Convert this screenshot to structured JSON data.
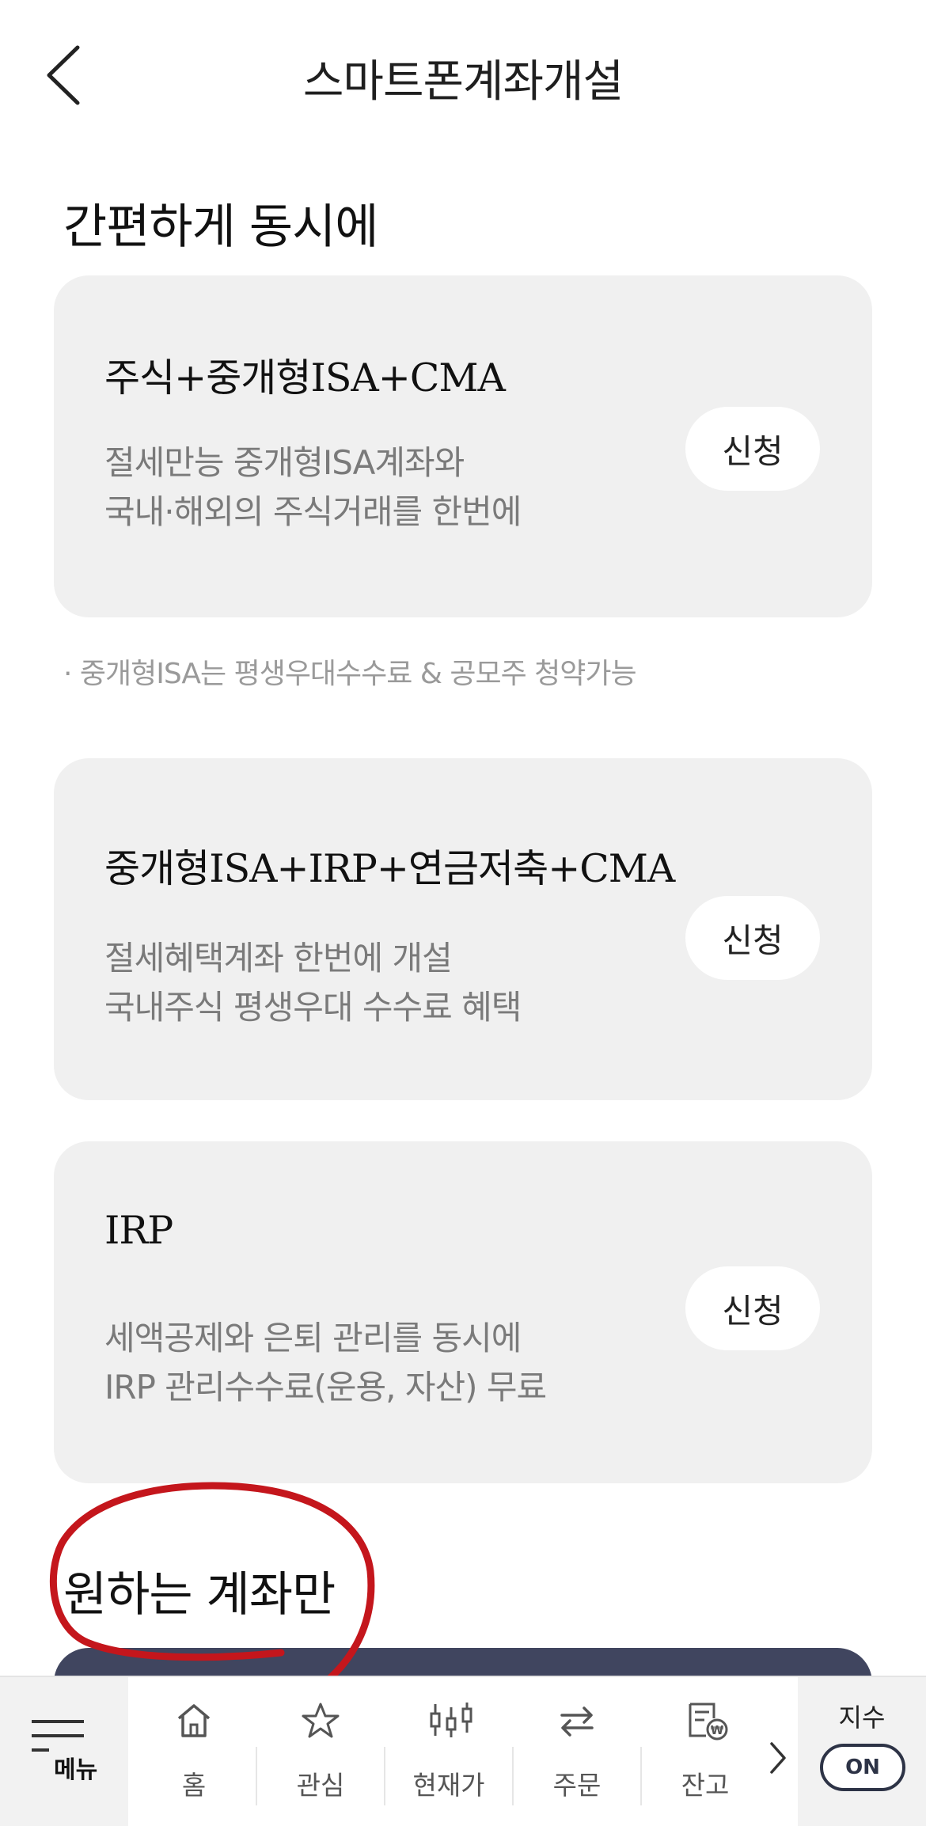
{
  "header": {
    "title": "스마트폰계좌개설"
  },
  "sections": {
    "simple": {
      "title": "간편하게 동시에"
    },
    "wanted": {
      "title": "원하는 계좌만"
    }
  },
  "cards": [
    {
      "title": "주식+중개형ISA+CMA",
      "desc": [
        "절세만능 중개형ISA계좌와",
        "국내·해외의 주식거래를 한번에"
      ],
      "button": "신청"
    },
    {
      "title": "중개형ISA+IRP+연금저축+CMA",
      "desc": [
        "절세혜택계좌 한번에 개설",
        "국내주식 평생우대 수수료 혜택"
      ],
      "button": "신청"
    },
    {
      "title": "IRP",
      "desc": [
        "세액공제와 은퇴 관리를 동시에",
        "IRP 관리수수료(운용, 자산) 무료"
      ],
      "button": "신청"
    }
  ],
  "note": "· 중개형ISA는 평생우대수수료 & 공모주 청약가능",
  "bottom_nav": {
    "menu_label": "메뉴",
    "items": [
      {
        "label": "홈",
        "icon": "home-icon"
      },
      {
        "label": "관심",
        "icon": "star-icon"
      },
      {
        "label": "현재가",
        "icon": "candlestick-icon"
      },
      {
        "label": "주문",
        "icon": "swap-icon"
      },
      {
        "label": "잔고",
        "icon": "balance-icon"
      }
    ],
    "index_label": "지수",
    "index_toggle": "ON"
  },
  "colors": {
    "card_bg": "#f0f0f0",
    "dark_strip": "#40455f",
    "annotation_red": "#c4161c"
  }
}
